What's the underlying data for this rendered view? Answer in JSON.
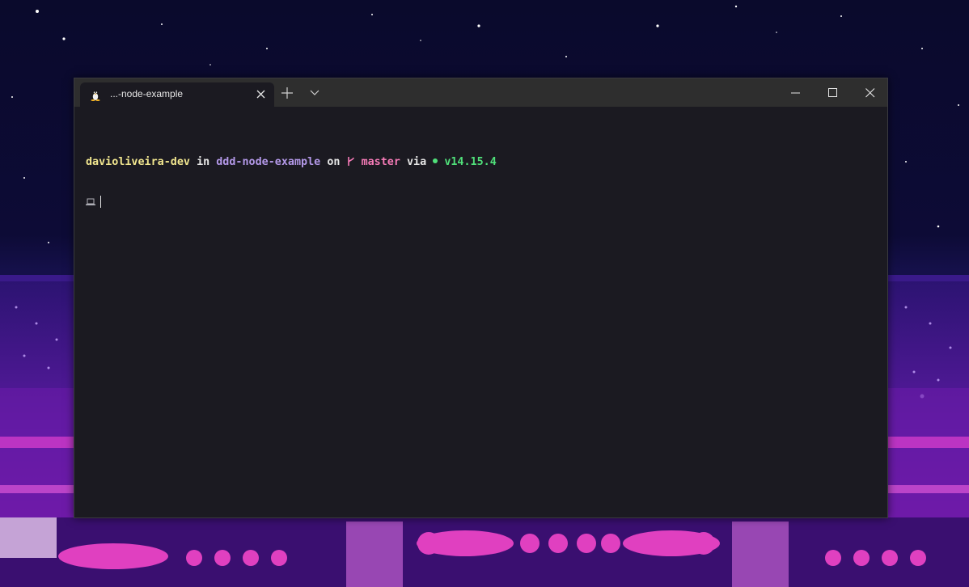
{
  "desktop": {
    "wallpaper": "purple-synthwave-pixel-city"
  },
  "window": {
    "tab": {
      "icon": "linux-penguin-icon",
      "title": "...-node-example"
    },
    "controls": {
      "new_tab_icon": "plus-icon",
      "dropdown_icon": "chevron-down-icon",
      "minimize_icon": "minimize-icon",
      "maximize_icon": "maximize-icon",
      "close_icon": "close-icon"
    }
  },
  "terminal": {
    "prompt": {
      "user": "davioliveira-dev",
      "in_word": "in",
      "directory": "ddd-node-example",
      "on_word": "on",
      "branch_icon": "git-branch-icon",
      "branch": "master",
      "via_word": "via",
      "node_icon": "node-dot-icon",
      "node_version": "v14.15.4",
      "input_icon": "laptop-icon"
    },
    "colors": {
      "background": "#1b1a21",
      "user": "#f1e68f",
      "text": "#e6e6e6",
      "directory": "#b398e8",
      "branch": "#f47ab6",
      "node": "#50e07a"
    }
  }
}
